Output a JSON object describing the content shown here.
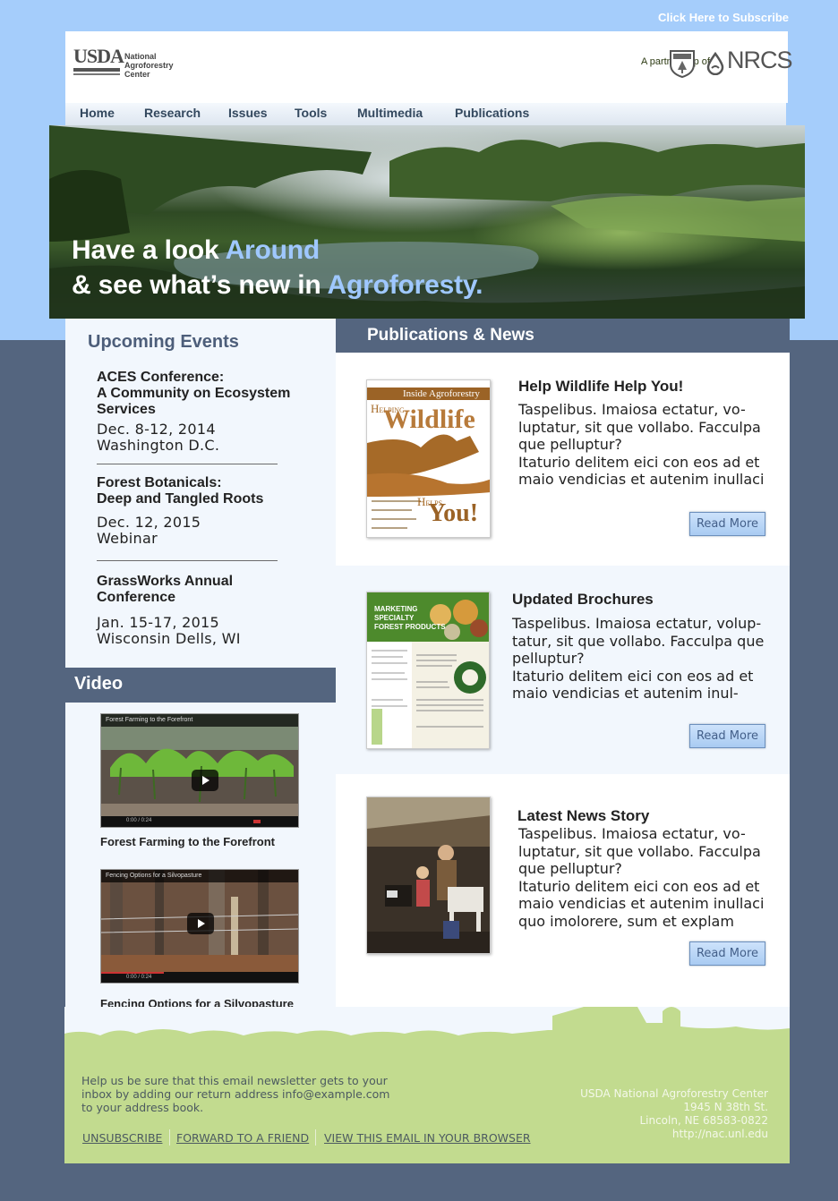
{
  "top": {
    "subscribe_label": "Click Here to Subscribe"
  },
  "header": {
    "logo_usda": "USDA",
    "logo_center_line1": "National",
    "logo_center_line2": "Agroforestry",
    "logo_center_line3": "Center",
    "partnership": "A partnership of",
    "nrcs": "NRCS"
  },
  "nav": {
    "items": [
      "Home",
      "Research",
      "Issues",
      "Tools",
      "Multimedia",
      "Publications"
    ]
  },
  "hero": {
    "line1_prefix": "Have a look ",
    "line1_accent": "Around",
    "line2_prefix": "& see what’s new in ",
    "line2_accent": "Agroforesty."
  },
  "events": {
    "title": "Upcoming Events",
    "items": [
      {
        "name": [
          "ACES Conference:",
          "A Community on Ecosystem",
          "Services"
        ],
        "date": "Dec. 8-12, 2014",
        "place": "Washington D.C."
      },
      {
        "name": [
          "Forest Botanicals:",
          "Deep and Tangled Roots"
        ],
        "date": "Dec. 12, 2015",
        "place": "Webinar"
      },
      {
        "name": [
          "GrassWorks Annual",
          "Conference"
        ],
        "date": "Jan. 15-17, 2015",
        "place": "Wisconsin Dells, WI"
      }
    ]
  },
  "video": {
    "title": "Video",
    "items": [
      {
        "overlay": "Forest Farming to the Forefront",
        "caption": "Forest Farming to the Forefront",
        "time": "0:00 / 0:24"
      },
      {
        "overlay": "Fencing Options for a Silvopasture",
        "caption": "Fencing Options for a Silvopasture",
        "time": "0:00 / 0:24"
      }
    ]
  },
  "publications": {
    "title": "Publications & News",
    "cards": [
      {
        "title": "Help Wildlife Help You!",
        "body": [
          "Taspelibus. Imaiosa ectatur, vo-",
          "luptatur, sit que vollabo. Facculpa",
          "que pelluptur?",
          "Itaturio delitem eici con eos ad et",
          "maio vendicias et autenim inullaci"
        ],
        "read_more": "Read More",
        "cover": {
          "masthead": "Inside Agroforestry",
          "word1": "Wildlife",
          "word2": "You!",
          "h1": "H",
          "h2": "ELPING",
          "h3": "H",
          "h4": "ELPS"
        }
      },
      {
        "title": "Updated Brochures",
        "body": [
          "Taspelibus. Imaiosa ectatur, volup-",
          "tatur, sit que vollabo. Facculpa que",
          "pelluptur?",
          "Itaturio delitem eici con eos ad et",
          "maio vendicias et autenim inul-"
        ],
        "read_more": "Read More",
        "cover": {
          "line1": "MARKETING",
          "line2": "SPECIALTY",
          "line3": "FOREST PRODUCTS"
        }
      },
      {
        "title": "Latest News Story",
        "body": [
          "Taspelibus. Imaiosa ectatur, vo-",
          "luptatur, sit que vollabo. Facculpa",
          "que pelluptur?",
          "Itaturio delitem eici con eos ad et",
          "maio vendicias et autenim inullaci",
          "quo imolorere, sum et explam"
        ],
        "read_more": "Read More"
      }
    ]
  },
  "footer": {
    "note": [
      "Help us be sure that this email newsletter gets to your",
      "inbox by adding our return address info@example.com",
      "to your address book."
    ],
    "links": [
      "UNSUBSCRIBE",
      "FORWARD TO A FRIEND",
      "VIEW THIS EMAIL IN YOUR BROWSER"
    ],
    "address": [
      "USDA National Agroforestry Center",
      "1945 N 38th St.",
      "Lincoln, NE 68583-0822",
      "http://nac.unl.edu"
    ]
  },
  "colors": {
    "sky": "#a5cdfb",
    "slate": "#54657f",
    "panel": "#f2f7fd",
    "grass": "#c2db8f",
    "accent_text": "#9fc8ff"
  }
}
